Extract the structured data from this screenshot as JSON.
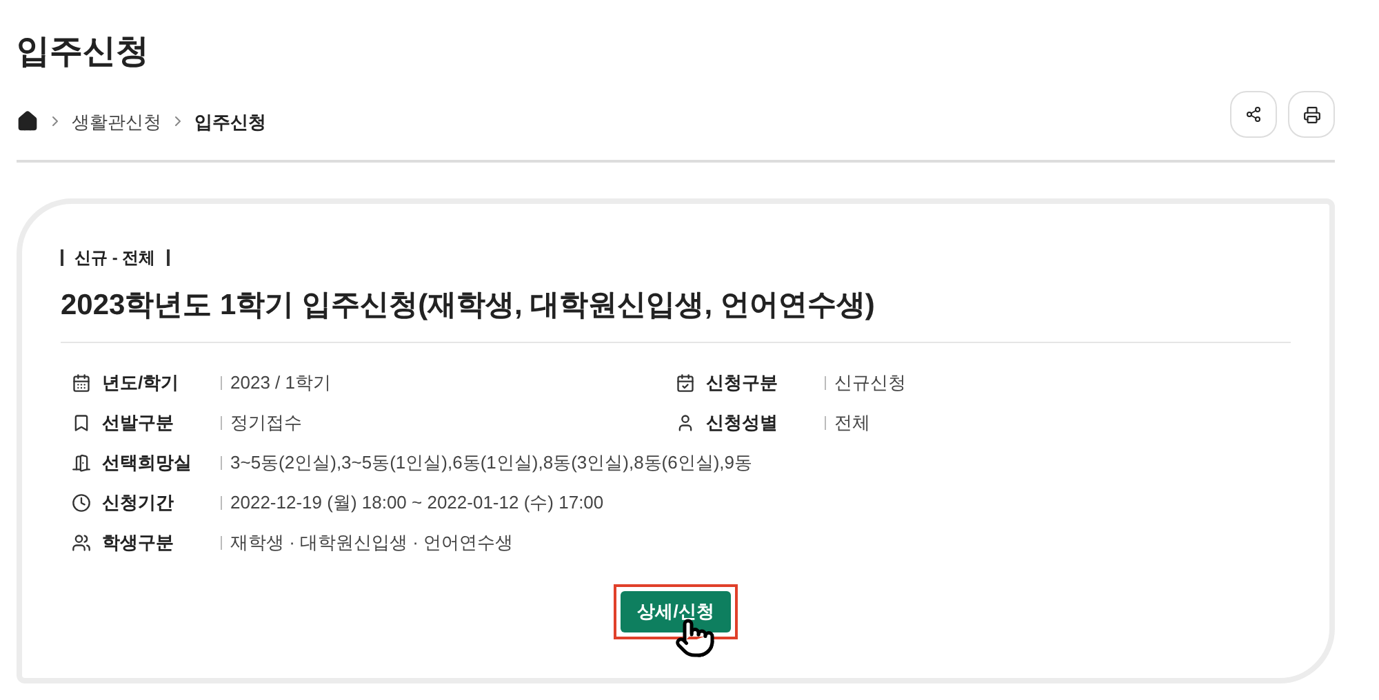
{
  "page_title": "입주신청",
  "breadcrumb": [
    "생활관신청",
    "입주신청"
  ],
  "card": {
    "tag": "신규 - 전체",
    "title": "2023학년도 1학기 입주신청(재학생, 대학원신입생, 언어연수생)",
    "rows": [
      {
        "cells": [
          {
            "label": "년도/학기",
            "value": "2023 / 1학기"
          },
          {
            "label": "신청구분",
            "value": "신규신청"
          }
        ]
      },
      {
        "cells": [
          {
            "label": "선발구분",
            "value": "정기접수"
          },
          {
            "label": "신청성별",
            "value": "전체"
          }
        ]
      },
      {
        "cells": [
          {
            "label": "선택희망실",
            "value": "3~5동(2인실),3~5동(1인실),6동(1인실),8동(3인실),8동(6인실),9동"
          }
        ]
      },
      {
        "cells": [
          {
            "label": "신청기간",
            "value": "2022-12-19 (월) 18:00 ~ 2022-01-12 (수) 17:00"
          }
        ]
      },
      {
        "cells": [
          {
            "label": "학생구분",
            "value": "재학생 · 대학원신입생 · 언어연수생"
          }
        ]
      }
    ],
    "button": {
      "label": "상세/신청",
      "highlighted": true
    }
  }
}
